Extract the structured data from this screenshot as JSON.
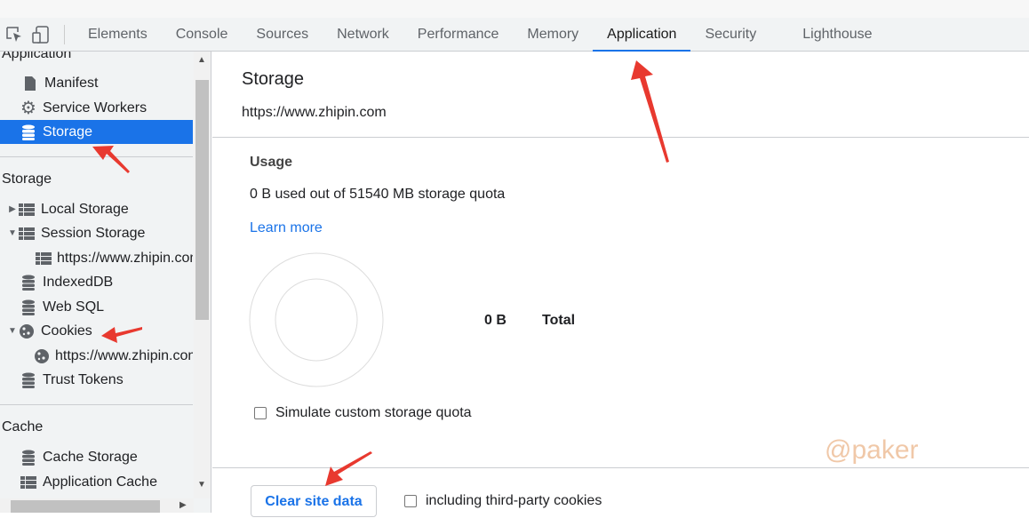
{
  "toolbar": {
    "tabs": [
      "Elements",
      "Console",
      "Sources",
      "Network",
      "Performance",
      "Memory",
      "Application",
      "Security",
      "Lighthouse"
    ],
    "active_tab": "Application"
  },
  "sidebar": {
    "section_application": "Application",
    "manifest": "Manifest",
    "service_workers": "Service Workers",
    "storage": "Storage",
    "section_storage": "Storage",
    "local_storage": "Local Storage",
    "session_storage": "Session Storage",
    "session_origin": "https://www.zhipin.com",
    "indexeddb": "IndexedDB",
    "web_sql": "Web SQL",
    "cookies": "Cookies",
    "cookies_origin": "https://www.zhipin.com",
    "trust_tokens": "Trust Tokens",
    "section_cache": "Cache",
    "cache_storage": "Cache Storage",
    "application_cache": "Application Cache"
  },
  "main": {
    "title": "Storage",
    "origin": "https://www.zhipin.com",
    "usage_heading": "Usage",
    "usage_text": "0 B used out of 51540 MB storage quota",
    "learn_more": "Learn more",
    "chart_value": "0 B",
    "chart_label": "Total",
    "simulate_quota": "Simulate custom storage quota",
    "clear_button": "Clear site data",
    "third_party": "including third-party cookies"
  },
  "watermark": "@paker",
  "colors": {
    "accent": "#1a73e8",
    "annotation": "#e8392f"
  }
}
